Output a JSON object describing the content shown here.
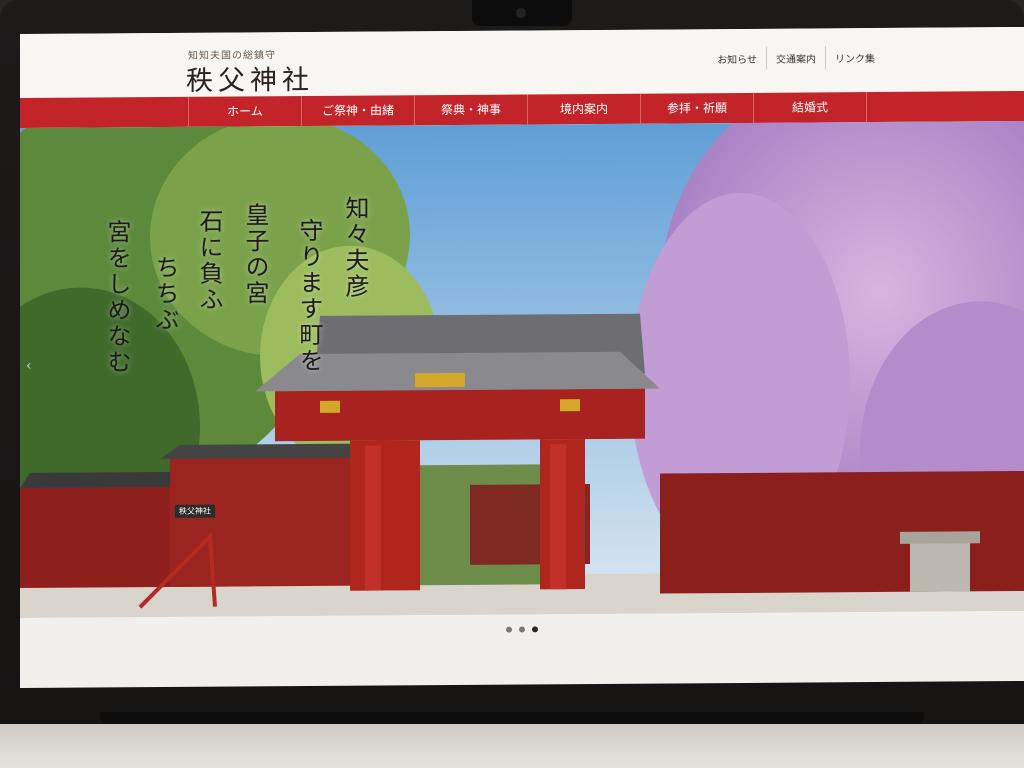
{
  "header": {
    "tagline": "知知夫国の総鎮守",
    "logo": "秩父神社",
    "utility_links": [
      "お知らせ",
      "交通案内",
      "リンク集"
    ]
  },
  "nav": {
    "items": [
      "ホーム",
      "ご祭神・由緒",
      "祭典・神事",
      "境内案内",
      "参拝・祈願",
      "結婚式"
    ],
    "active": "ホーム"
  },
  "hero": {
    "calligraphy": [
      "知々夫彦",
      "守ります町を",
      "皇子の宮",
      "石に負ふ",
      "ちちぶ",
      "宮をしめなむ"
    ],
    "sign": "秩父神社"
  },
  "slider": {
    "slides": 3,
    "active_index": 2
  },
  "colors": {
    "nav_red": "#c2242a",
    "gate_red": "#a8231f",
    "blossom": "#c9a6d6"
  }
}
